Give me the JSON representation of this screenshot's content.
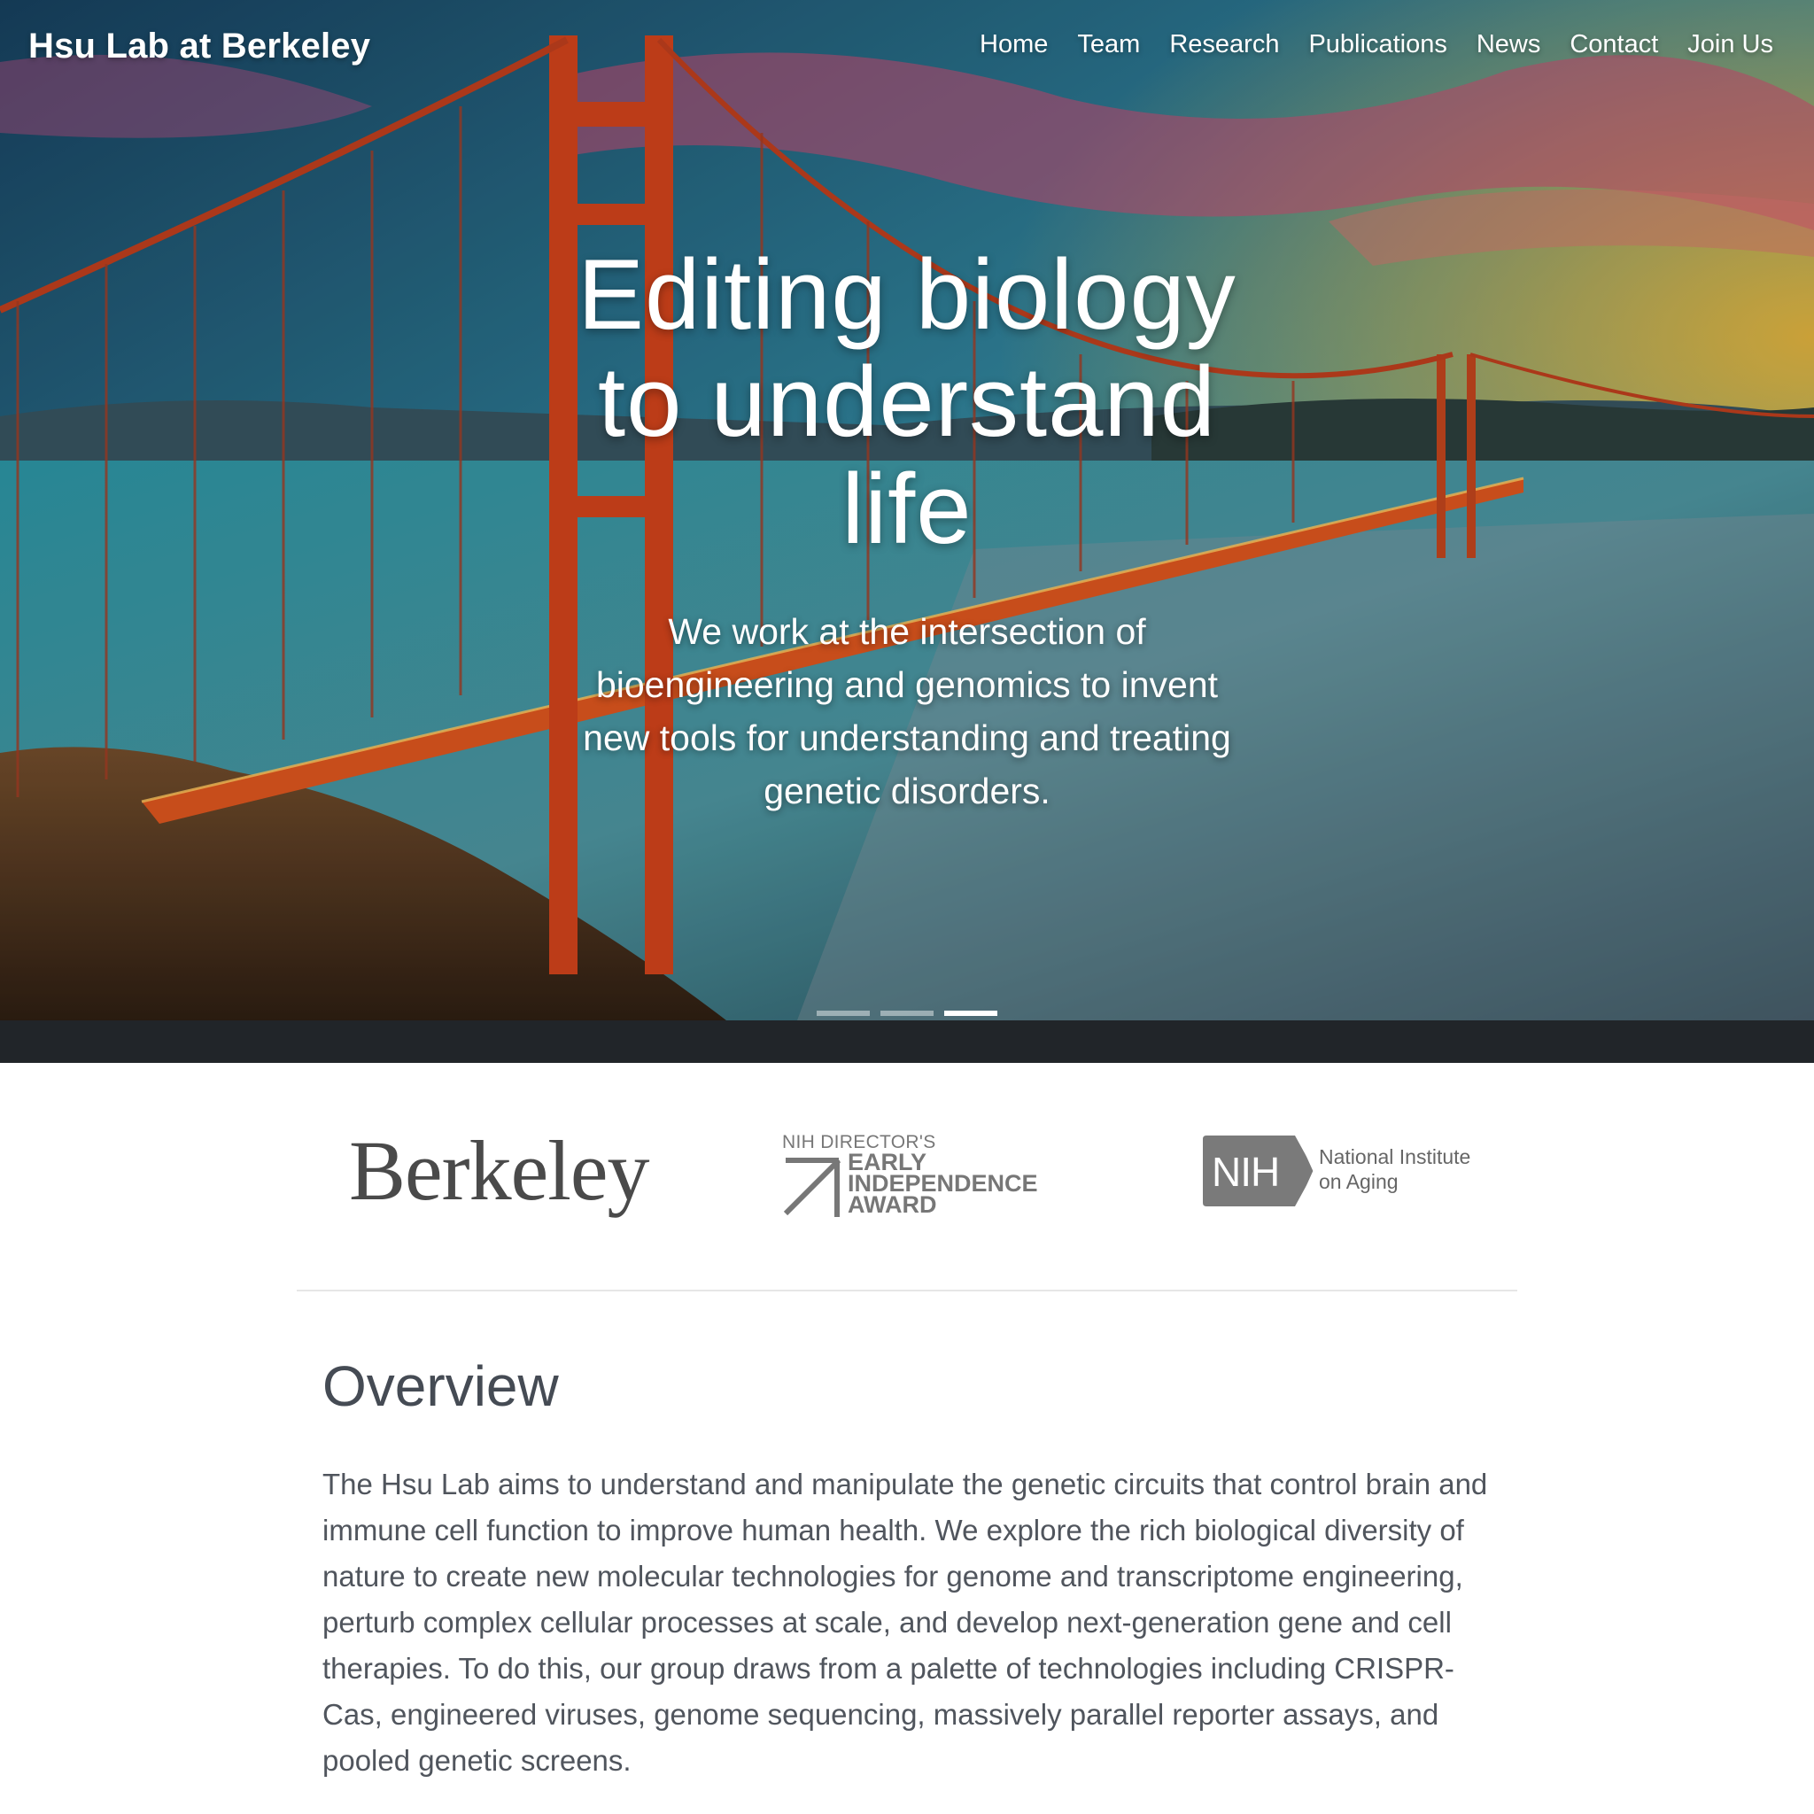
{
  "brand": {
    "name": "Hsu Lab at Berkeley"
  },
  "nav": {
    "items": [
      "Home",
      "Team",
      "Research",
      "Publications",
      "News",
      "Contact",
      "Join Us"
    ]
  },
  "hero": {
    "title": "Editing biology to understand life",
    "subtitle": "We work at the intersection of bioengineering and genomics to invent new tools for understanding and treating genetic disorders.",
    "carousel": {
      "slides": 3,
      "active_slide": 3
    },
    "image": "golden-gate-bridge-at-sunset-photo"
  },
  "logos": {
    "berkeley": "Berkeley",
    "early_independence": {
      "top": "NIH DIRECTOR'S",
      "lines": [
        "EARLY",
        "INDEPENDENCE",
        "AWARD"
      ]
    },
    "nih": {
      "badge": "NIH",
      "lines": [
        "National Institute",
        "on Aging"
      ]
    }
  },
  "overview": {
    "title": "Overview",
    "text": "The Hsu Lab aims to understand and manipulate the genetic circuits that control brain and immune cell function to improve human health. We explore the rich biological diversity of nature to create new molecular technologies for genome and transcriptome engineering, perturb complex cellular processes at scale, and develop next-generation gene and cell therapies. To do this, our group draws from a palette of technologies including CRISPR-Cas, engineered viruses, genome sequencing, massively parallel reporter assays, and pooled genetic screens."
  },
  "colors": {
    "dark_band": "#212529",
    "text": "#50555d",
    "heading": "#454b54",
    "logo_gray": "#777777"
  }
}
